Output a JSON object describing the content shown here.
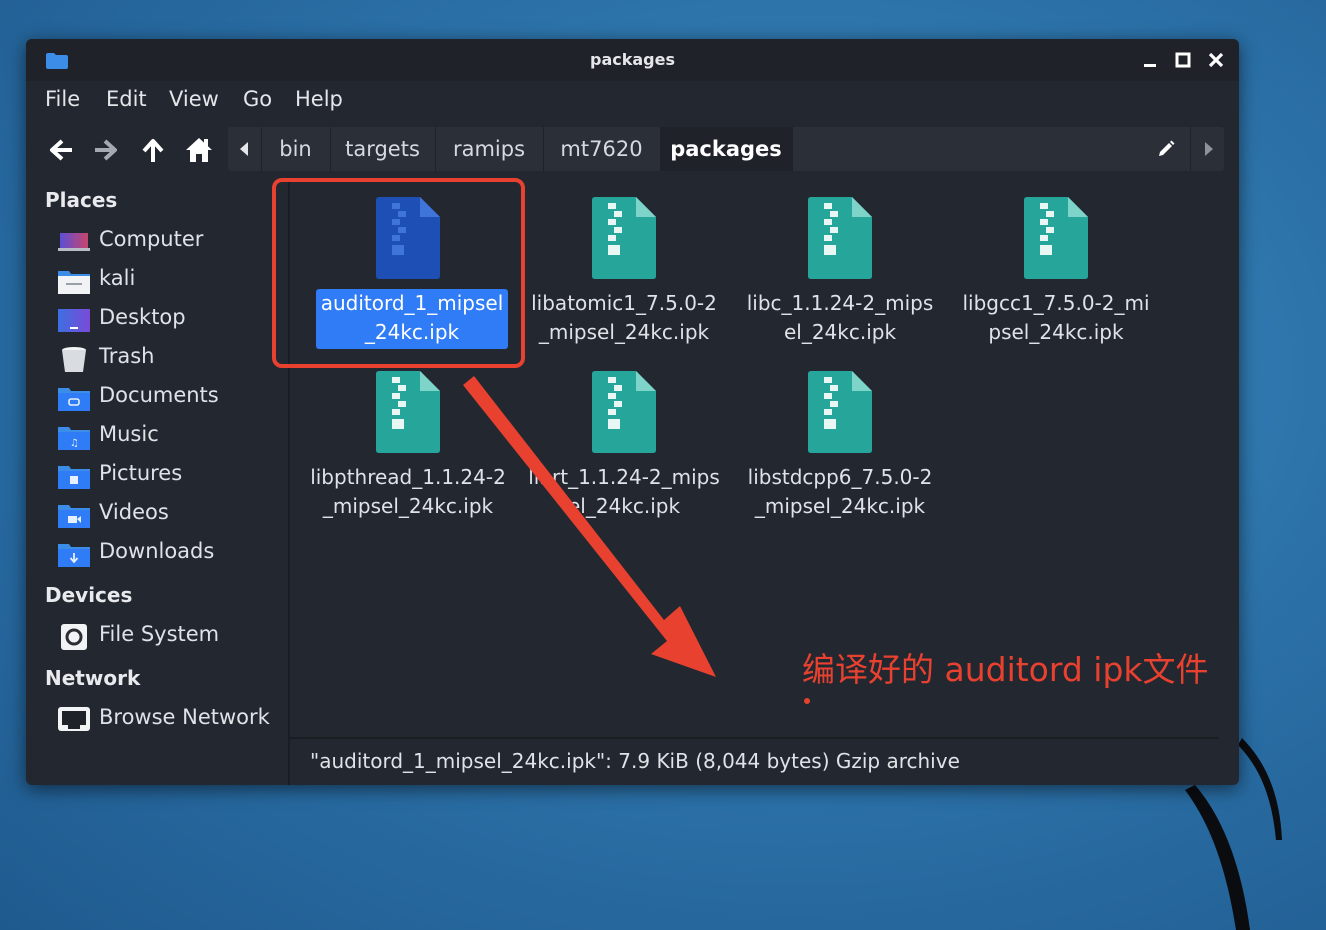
{
  "window": {
    "title": "packages",
    "controls": [
      "minimize-icon",
      "maximize-icon",
      "close-icon"
    ]
  },
  "menu": [
    "File",
    "Edit",
    "View",
    "Go",
    "Help"
  ],
  "nav": {
    "buttons": [
      "back-arrow-icon",
      "forward-arrow-icon",
      "up-arrow-icon",
      "home-icon"
    ],
    "breadcrumbs": [
      "bin",
      "targets",
      "ramips",
      "mt7620",
      "packages"
    ],
    "active_crumb": "packages"
  },
  "sidebar": {
    "places_title": "Places",
    "places": [
      {
        "label": "Computer",
        "icon": "computer-icon"
      },
      {
        "label": "kali",
        "icon": "home-folder-icon"
      },
      {
        "label": "Desktop",
        "icon": "desktop-icon"
      },
      {
        "label": "Trash",
        "icon": "trash-icon"
      },
      {
        "label": "Documents",
        "icon": "documents-folder-icon"
      },
      {
        "label": "Music",
        "icon": "music-folder-icon"
      },
      {
        "label": "Pictures",
        "icon": "pictures-folder-icon"
      },
      {
        "label": "Videos",
        "icon": "videos-folder-icon"
      },
      {
        "label": "Downloads",
        "icon": "downloads-folder-icon"
      }
    ],
    "devices_title": "Devices",
    "devices": [
      {
        "label": "File System",
        "icon": "drive-icon"
      }
    ],
    "network_title": "Network",
    "network": [
      {
        "label": "Browse Network",
        "icon": "network-icon"
      }
    ]
  },
  "files": [
    {
      "line1": "auditord_1_mipsel",
      "line2": "_24kc.ipk",
      "selected": true
    },
    {
      "line1": "libatomic1_7.5.0-2",
      "line2": "_mipsel_24kc.ipk",
      "selected": false
    },
    {
      "line1": "libc_1.1.24-2_mips",
      "line2": "el_24kc.ipk",
      "selected": false
    },
    {
      "line1": "libgcc1_7.5.0-2_mi",
      "line2": "psel_24kc.ipk",
      "selected": false
    },
    {
      "line1": "libpthread_1.1.24-2",
      "line2": "_mipsel_24kc.ipk",
      "selected": false
    },
    {
      "line1": "librt_1.1.24-2_mips",
      "line2": "el_24kc.ipk",
      "selected": false
    },
    {
      "line1": "libstdcpp6_7.5.0-2",
      "line2": "_mipsel_24kc.ipk",
      "selected": false
    }
  ],
  "status": "\"auditord_1_mipsel_24kc.ipk\": 7.9 KiB (8,044 bytes) Gzip archive",
  "annotation": "编译好的 auditord ipk文件",
  "colors": {
    "selection": "#2f7cf6",
    "archive_icon": "#26a69a",
    "selected_icon": "#1e4fb5",
    "annotation": "#e8412f",
    "window_bg": "#232730"
  }
}
